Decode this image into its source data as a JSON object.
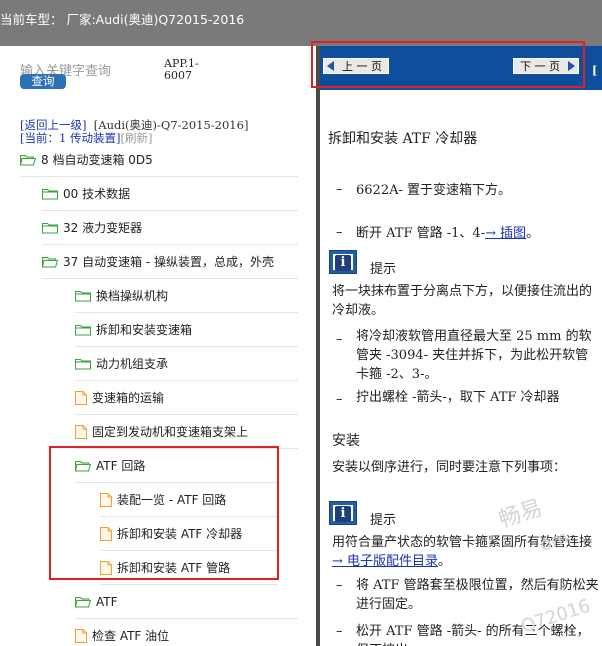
{
  "header": {
    "title": "当前车型：  厂家:Audi(奥迪)Q72015-2016"
  },
  "sidebar": {
    "search_placeholder": "输入关键字查询",
    "search_button": "查询",
    "app_code": "APP.1-6007",
    "back_link": "[返回上一级]",
    "model": "[Audi(奥迪)-Q7-2015-2016]",
    "current": "[当前：1 传动装置]",
    "refresh": "[刷新]",
    "tree": [
      {
        "label": "8 档自动变速箱 0D5",
        "icon": "folder-open-icon"
      },
      {
        "label": "00 技术数据",
        "icon": "folder-icon"
      },
      {
        "label": "32 液力变矩器",
        "icon": "folder-icon"
      },
      {
        "label": "37 自动变速箱 - 操纵装置，总成，外壳",
        "icon": "folder-open-icon"
      },
      {
        "label": "换档操纵机构",
        "icon": "folder-icon"
      },
      {
        "label": "拆卸和安装变速箱",
        "icon": "folder-icon"
      },
      {
        "label": "动力机组支承",
        "icon": "folder-icon"
      },
      {
        "label": "变速箱的运输",
        "icon": "document-icon"
      },
      {
        "label": "固定到发动机和变速箱支架上",
        "icon": "document-icon"
      },
      {
        "label": "ATF 回路",
        "icon": "folder-open-icon"
      },
      {
        "label": "装配一览 - ATF 回路",
        "icon": "document-icon"
      },
      {
        "label": "拆卸和安装 ATF 冷却器",
        "icon": "document-icon"
      },
      {
        "label": "拆卸和安装 ATF 管路",
        "icon": "document-icon"
      },
      {
        "label": "ATF",
        "icon": "folder-open-icon"
      },
      {
        "label": "检查 ATF 油位",
        "icon": "document-icon"
      }
    ]
  },
  "toolbar": {
    "prev_label": "上 一 页",
    "next_label": "下 一 页",
    "edge_text": "[ "
  },
  "content": {
    "title": "拆卸和安装  ATF 冷却器",
    "step1": "6622A- 置于变速箱下方。",
    "step2_text": "断开  ATF 管路  -1、4-",
    "step2_link": "→ 插图",
    "step2_tail": "。",
    "note_label": "提示",
    "note1": "将一块抹布置于分离点下方，以便接住流出的冷却液。",
    "step3": "将冷却液软管用直径最大至  25 mm 的软管夹  -3094- 夹住并拆下，为此松开软管卡箍  -2、3-。",
    "step4": "拧出螺栓  -箭头-，取下  ATF 冷却器",
    "install_heading": "安装",
    "install_text": "安装以倒序进行，同时要注意下列事项：",
    "note2_label": "提示",
    "note2_text": "用符合量产状态的软管卡箍紧固所有软管连接",
    "note2_link": "→ 电子版配件目录",
    "note2_tail": "。",
    "step5": "将  ATF 管路套至极限位置，然后有防松夹进行固定。",
    "step6": "松开  ATF 管路  -箭头- 的所有三个螺栓，但不拧出。",
    "watermark1": "畅易",
    "watermark2": "Q72016",
    "watermark3": "om"
  },
  "colors": {
    "highlight": "#e0212b",
    "nav_bar": "#0f4e9a",
    "search_button": "#2d71b6",
    "folder_green": "#3aa23a",
    "document_orange": "#f0a030",
    "link": "#1a35b8"
  }
}
